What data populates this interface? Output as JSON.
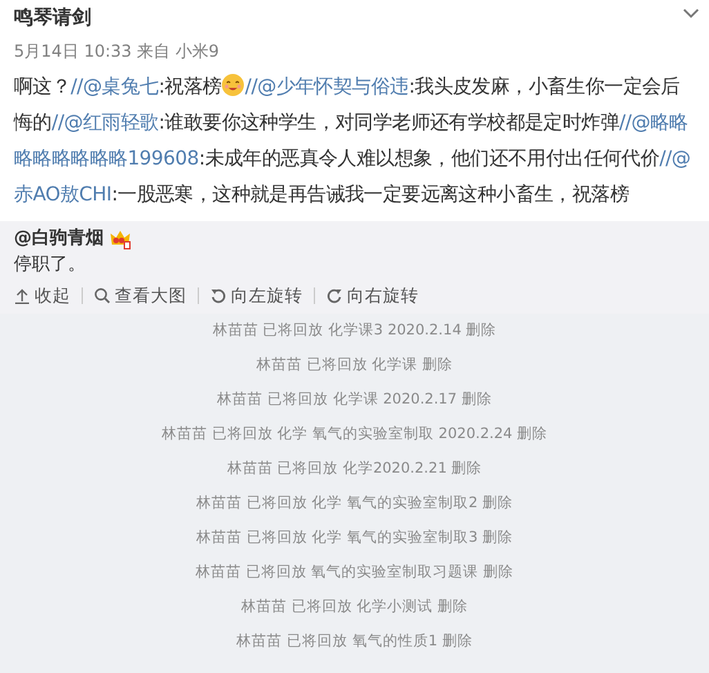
{
  "post": {
    "author": "鸣琴请剑",
    "meta": "5月14日 10:33 来自 小米9",
    "lines": [
      [
        {
          "kind": "plain",
          "text": "啊这？"
        },
        {
          "kind": "link",
          "text": "//@桌兔七"
        },
        {
          "kind": "plain",
          "text": ":祝落榜"
        },
        {
          "kind": "emoji"
        },
        {
          "kind": "link",
          "text": "//@少年怀契与俗违"
        },
        {
          "kind": "plain",
          "text": ":我头皮发麻，小畜生你一定会后"
        }
      ],
      [
        {
          "kind": "plain",
          "text": "悔的"
        },
        {
          "kind": "link",
          "text": "//@红雨轻歌"
        },
        {
          "kind": "plain",
          "text": ":谁敢要你这种学生，对同学老师还有学校都是定时炸弹"
        },
        {
          "kind": "link",
          "text": "//@略略"
        }
      ],
      [
        {
          "kind": "link",
          "text": "略略略略略略199608"
        },
        {
          "kind": "plain",
          "text": ":未成年的恶真令人难以想象，他们还不用付出任何代价"
        },
        {
          "kind": "link",
          "text": "//@"
        }
      ],
      [
        {
          "kind": "link",
          "text": "赤AO敖CHI"
        },
        {
          "kind": "plain",
          "text": ":一股恶寒，这种就是再告诫我一定要远离这种小畜生，祝落榜"
        }
      ]
    ]
  },
  "repost": {
    "author": "@白驹青烟",
    "text": "停职了。",
    "tools": [
      {
        "kind": "collapse",
        "label": "收起"
      },
      {
        "kind": "zoom",
        "label": "查看大图"
      },
      {
        "kind": "rotate-left",
        "label": "向左旋转"
      },
      {
        "kind": "rotate-right",
        "label": "向右旋转"
      }
    ],
    "image_rows": [
      "林苗苗 已将回放 化学课3 2020.2.14 删除",
      "林苗苗 已将回放 化学课 删除",
      "林苗苗 已将回放 化学课 2020.2.17 删除",
      "林苗苗 已将回放 化学 氧气的实验室制取 2020.2.24 删除",
      "林苗苗 已将回放 化学2020.2.21 删除",
      "林苗苗 已将回放 化学 氧气的实验室制取2 删除",
      "林苗苗 已将回放 化学 氧气的实验室制取3 删除",
      "林苗苗 已将回放 氧气的实验室制取习题课 删除",
      "林苗苗 已将回放 化学小测试 删除",
      "林苗苗 已将回放 氧气的性质1 删除"
    ]
  }
}
